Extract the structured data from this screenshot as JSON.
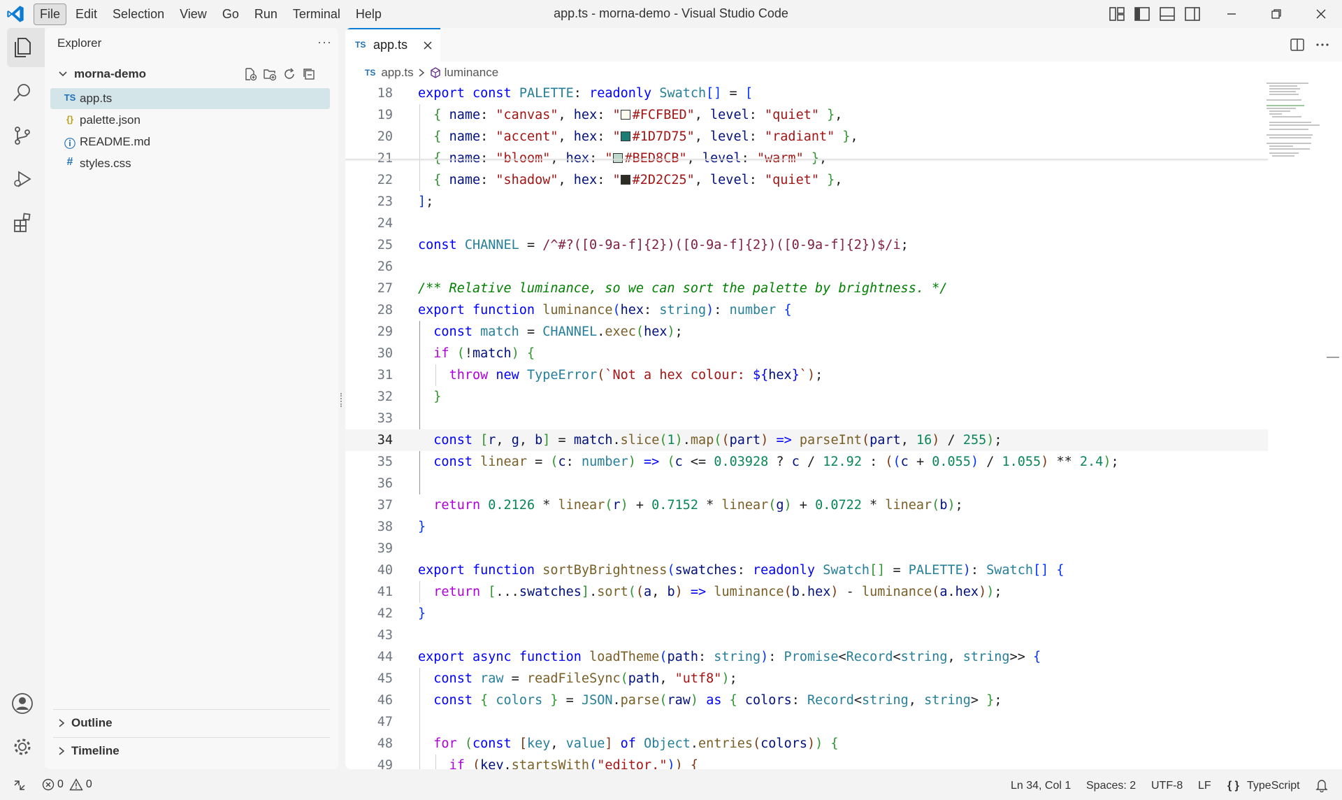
{
  "window": {
    "title": "app.ts - morna-demo - Visual Studio Code",
    "menu": [
      "File",
      "Edit",
      "Selection",
      "View",
      "Go",
      "Run",
      "Terminal",
      "Help"
    ],
    "active_menu": "File"
  },
  "icons": {
    "activity": [
      "explorer-icon",
      "search-icon",
      "source-control-icon",
      "run-debug-icon",
      "extensions-icon",
      "account-icon",
      "gear-icon"
    ],
    "layout": [
      "customize-layout-icon",
      "toggle-primary-sidebar-icon",
      "toggle-panel-icon",
      "toggle-secondary-sidebar-icon"
    ],
    "window_controls": [
      "minimize-icon",
      "restore-icon",
      "close-icon"
    ]
  },
  "sidebar": {
    "title": "Explorer",
    "more": "···",
    "folder": "morna-demo",
    "files": [
      {
        "icon": "TS",
        "icon_color": "#1f6fb5",
        "name": "app.ts",
        "selected": true
      },
      {
        "icon": "{}",
        "icon_color": "#b8a21c",
        "name": "palette.json"
      },
      {
        "icon": "ⓘ",
        "icon_color": "#1f6fb5",
        "name": "README.md"
      },
      {
        "icon": "#",
        "icon_color": "#1f6fb5",
        "name": "styles.css"
      }
    ],
    "panels": [
      "Outline",
      "Timeline"
    ]
  },
  "editor": {
    "tab": {
      "icon": "TS",
      "name": "app.ts"
    },
    "breadcrumb": {
      "file": "app.ts",
      "symbol": "luminance"
    },
    "current_line": 34,
    "swatch_colors": {
      "canvas": "#FCFBED",
      "accent": "#1D7D75",
      "bloom": "#BED8CB",
      "shadow": "#2D2C25"
    },
    "lines": [
      {
        "n": 18,
        "text": "export const PALETTE: readonly Swatch[] = ["
      },
      {
        "n": 19,
        "text": "  { name: \"canvas\", hex: \"#FCFBED\", level: \"quiet\" },"
      },
      {
        "n": 20,
        "text": "  { name: \"accent\", hex: \"#1D7D75\", level: \"radiant\" },"
      },
      {
        "n": 21,
        "text": "  { name: \"bloom\", hex: \"#BED8CB\", level: \"warm\" },"
      },
      {
        "n": 22,
        "text": "  { name: \"shadow\", hex: \"#2D2C25\", level: \"quiet\" },"
      },
      {
        "n": 23,
        "text": "];"
      },
      {
        "n": 24,
        "text": ""
      },
      {
        "n": 25,
        "text": "const CHANNEL = /^#?([0-9a-f]{2})([0-9a-f]{2})([0-9a-f]{2})$/i;"
      },
      {
        "n": 26,
        "text": ""
      },
      {
        "n": 27,
        "text": "/** Relative luminance, so we can sort the palette by brightness. */"
      },
      {
        "n": 28,
        "text": "export function luminance(hex: string): number {"
      },
      {
        "n": 29,
        "text": "  const match = CHANNEL.exec(hex);"
      },
      {
        "n": 30,
        "text": "  if (!match) {"
      },
      {
        "n": 31,
        "text": "    throw new TypeError(`Not a hex colour: ${hex}`);"
      },
      {
        "n": 32,
        "text": "  }"
      },
      {
        "n": 33,
        "text": ""
      },
      {
        "n": 34,
        "text": "  const [r, g, b] = match.slice(1).map((part) => parseInt(part, 16) / 255);"
      },
      {
        "n": 35,
        "text": "  const linear = (c: number) => (c <= 0.03928 ? c / 12.92 : ((c + 0.055) / 1.055) ** 2.4);"
      },
      {
        "n": 36,
        "text": ""
      },
      {
        "n": 37,
        "text": "  return 0.2126 * linear(r) + 0.7152 * linear(g) + 0.0722 * linear(b);"
      },
      {
        "n": 38,
        "text": "}"
      },
      {
        "n": 39,
        "text": ""
      },
      {
        "n": 40,
        "text": "export function sortByBrightness(swatches: readonly Swatch[] = PALETTE): Swatch[] {"
      },
      {
        "n": 41,
        "text": "  return [...swatches].sort((a, b) => luminance(b.hex) - luminance(a.hex));"
      },
      {
        "n": 42,
        "text": "}"
      },
      {
        "n": 43,
        "text": ""
      },
      {
        "n": 44,
        "text": "export async function loadTheme(path: string): Promise<Record<string, string>> {"
      },
      {
        "n": 45,
        "text": "  const raw = readFileSync(path, \"utf8\");"
      },
      {
        "n": 46,
        "text": "  const { colors } = JSON.parse(raw) as { colors: Record<string, string> };"
      },
      {
        "n": 47,
        "text": ""
      },
      {
        "n": 48,
        "text": "  for (const [key, value] of Object.entries(colors)) {"
      },
      {
        "n": 49,
        "text": "    if (key.startsWith(\"editor.\")) {"
      }
    ]
  },
  "status": {
    "errors": "0",
    "warnings": "0",
    "position": "Ln 34, Col 1",
    "spaces": "Spaces: 2",
    "encoding": "UTF-8",
    "eol": "LF",
    "language_icon": "{ }",
    "language": "TypeScript"
  }
}
